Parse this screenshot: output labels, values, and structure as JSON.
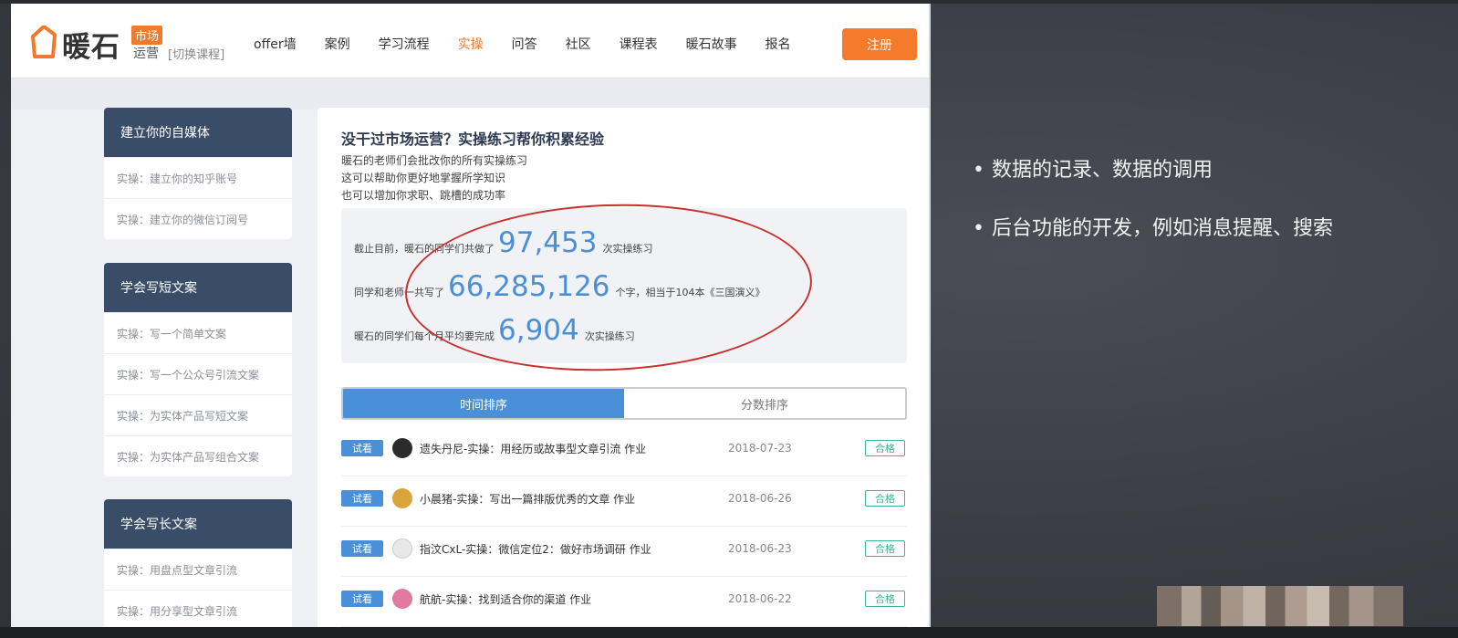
{
  "header": {
    "logo_main": "暖石",
    "logo_tag": "市场",
    "logo_sub": "运营",
    "logo_switch": "[切换课程]",
    "nav": [
      "offer墙",
      "案例",
      "学习流程",
      "实操",
      "问答",
      "社区",
      "课程表",
      "暖石故事",
      "报名"
    ],
    "active_nav_index": 3,
    "register_label": "注册"
  },
  "sidebar": [
    {
      "title": "建立你的自媒体",
      "items": [
        "实操：建立你的知乎账号",
        "实操：建立你的微信订阅号"
      ]
    },
    {
      "title": "学会写短文案",
      "items": [
        "实操：写一个简单文案",
        "实操：写一个公众号引流文案",
        "实操：为实体产品写短文案",
        "实操：为实体产品写组合文案"
      ]
    },
    {
      "title": "学会写长文案",
      "items": [
        "实操：用盘点型文章引流",
        "实操：用分享型文章引流"
      ]
    }
  ],
  "main": {
    "title": "没干过市场运营？实操练习帮你积累经验",
    "lines": [
      "暖石的老师们会批改你的所有实操练习",
      "这可以帮助你更好地掌握所学知识",
      "也可以增加你求职、跳槽的成功率"
    ],
    "stats": [
      {
        "prefix": "截止目前，暖石的同学们共做了",
        "value": "97,453",
        "suffix": "次实操练习"
      },
      {
        "prefix": "同学和老师一共写了",
        "value": "66,285,126",
        "suffix": "个字，相当于104本《三国演义》"
      },
      {
        "prefix": "暖石的同学们每个月平均要完成",
        "value": "6,904",
        "suffix": "次实操练习"
      }
    ],
    "tabs": [
      "时间排序",
      "分数排序"
    ],
    "active_tab": 0,
    "rows": [
      {
        "badge": "试看",
        "title": "遗失丹尼-实操：用经历或故事型文章引流 作业",
        "date": "2018-07-23",
        "status": "合格",
        "avatar_color": "#2b2b2b"
      },
      {
        "badge": "试看",
        "title": "小晨猪-实操：写出一篇排版优秀的文章 作业",
        "date": "2018-06-26",
        "status": "合格",
        "avatar_color": "#d9a43a"
      },
      {
        "badge": "试看",
        "title": "指汶CxL-实操：微信定位2：做好市场调研 作业",
        "date": "2018-06-23",
        "status": "合格",
        "avatar_color": "#e8e8e8"
      },
      {
        "badge": "试看",
        "title": "航航-实操：找到适合你的渠道 作业",
        "date": "2018-06-22",
        "status": "合格",
        "avatar_color": "#e07aa0"
      }
    ]
  },
  "slide": {
    "bullets": [
      "数据的记录、数据的调用",
      "后台功能的开发，例如消息提醒、搜索"
    ]
  },
  "colors": {
    "accent_orange": "#f47a2c",
    "accent_blue": "#4a90d9",
    "sidebar_head": "#3a4d68",
    "pass_green": "#3cb59a",
    "annotation_red": "#c8312d"
  }
}
